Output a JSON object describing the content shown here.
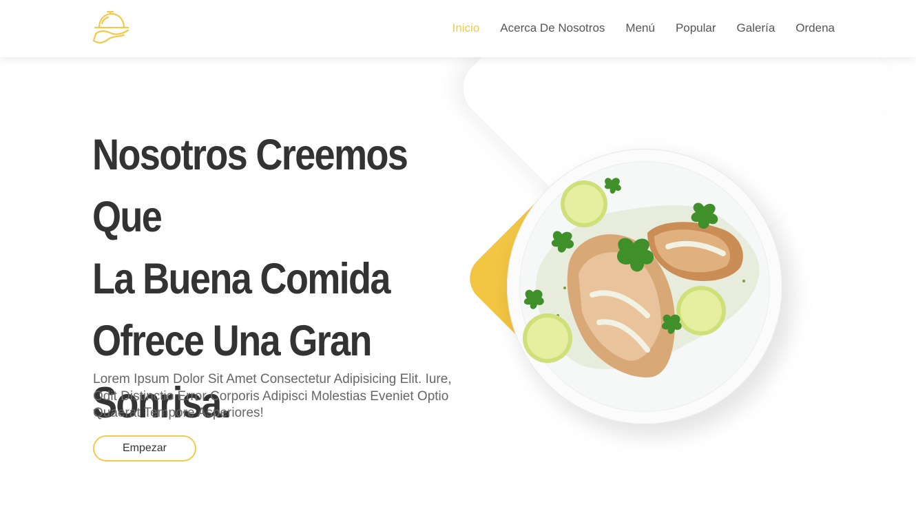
{
  "brand": {
    "logo_icon": "cloche-serving-tray-icon",
    "accent_color": "#f2c94c"
  },
  "nav": {
    "items": [
      {
        "label": "Inicio",
        "active": true
      },
      {
        "label": "Acerca De Nosotros",
        "active": false
      },
      {
        "label": "Menú",
        "active": false
      },
      {
        "label": "Popular",
        "active": false
      },
      {
        "label": "Galería",
        "active": false
      },
      {
        "label": "Ordena",
        "active": false
      }
    ]
  },
  "hero": {
    "title_lines": [
      "Nosotros Creemos Que",
      "La Buena Comida",
      "Ofrece Una Gran",
      "Sonrisa."
    ],
    "description": "Lorem Ipsum Dolor Sit Amet Consectetur Adipisicing Elit. Iure, Odit Distinctio Error Corporis Adipisci Molestias Eveniet Optio Quaerat Tempore Asperiores!",
    "button_label": "Empezar",
    "image_icon": "grilled-chicken-plate-icon"
  }
}
